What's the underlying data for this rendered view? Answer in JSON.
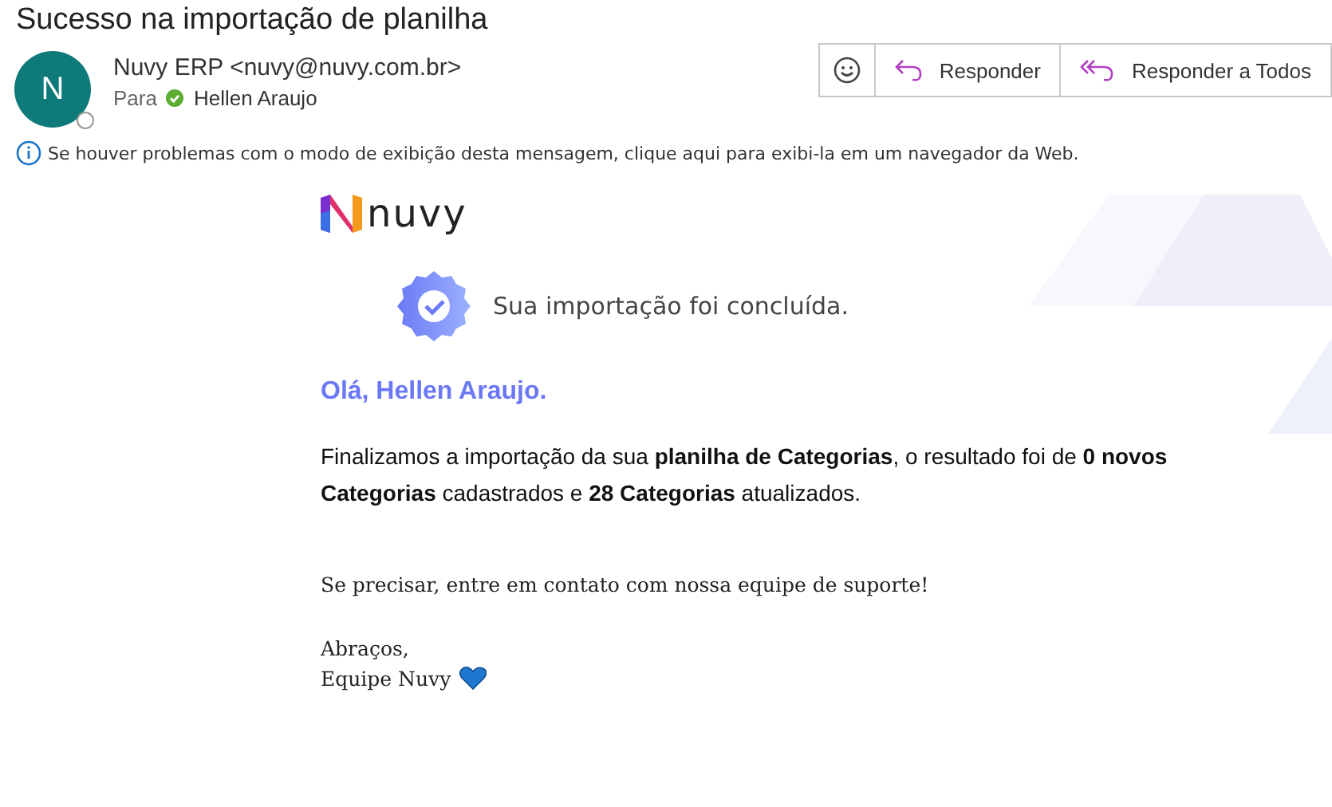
{
  "subject": "Sucesso na importação de planilha",
  "sender": {
    "initial": "N",
    "name": "Nuvy ERP <nuvy@nuvy.com.br>",
    "to_label": "Para",
    "recipient": "Hellen Araujo"
  },
  "actions": [
    {
      "kind": "emoji"
    },
    {
      "kind": "reply",
      "label": "Responder"
    },
    {
      "kind": "reply_all",
      "label": "Responder a Todos"
    }
  ],
  "info": "Se houver problemas com o modo de exibição desta mensagem, clique aqui para exibi-la em um navegador da Web.",
  "body": {
    "logo_text": "nuvy",
    "banner": "Sua importação foi concluída.",
    "greeting": "Olá, Hellen Araujo.",
    "paragraph": "Finalizamos a importação da sua **planilha de Categorias**, o resultado foi de **0 novos Categorias** cadastrados e **28 Categorias** atualizados.",
    "support": "Se precisar, entre em contato com nossa equipe de suporte!",
    "closing": "Abraços,",
    "signature": "Equipe Nuvy"
  }
}
